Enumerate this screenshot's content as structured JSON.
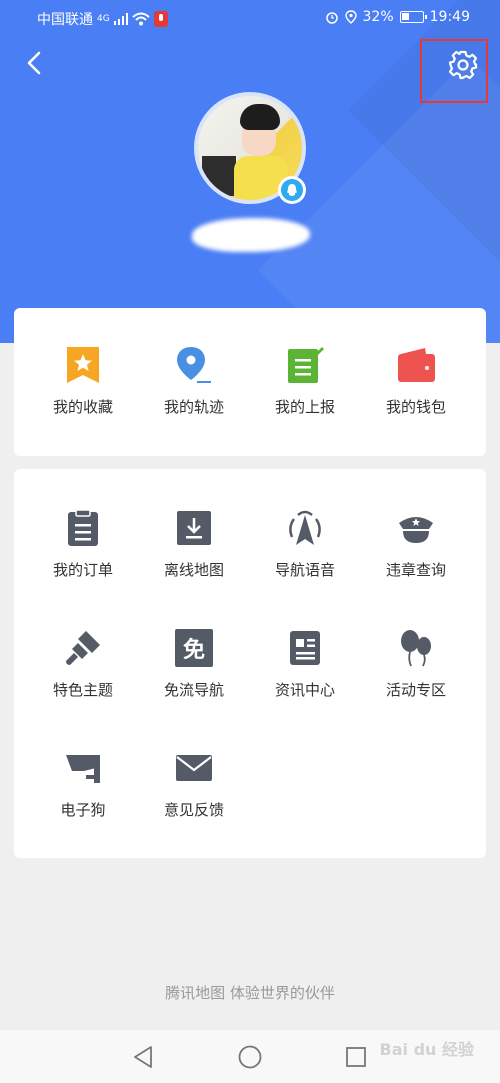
{
  "status_bar": {
    "carrier": "中国联通",
    "network": "4G",
    "battery": "32%",
    "time": "19:49"
  },
  "header": {
    "bg_color": "#4a7ef4",
    "back_icon": "chevron-left-icon",
    "settings_icon": "gear-icon",
    "highlight_color": "#e53935"
  },
  "quick_actions": [
    {
      "label": "我的收藏",
      "icon": "bookmark-star-icon",
      "color": "#f6a623"
    },
    {
      "label": "我的轨迹",
      "icon": "location-pin-icon",
      "color": "#4a90e2"
    },
    {
      "label": "我的上报",
      "icon": "report-note-icon",
      "color": "#5bb434"
    },
    {
      "label": "我的钱包",
      "icon": "wallet-icon",
      "color": "#ef5350"
    }
  ],
  "tools": [
    {
      "label": "我的订单",
      "icon": "clipboard-icon"
    },
    {
      "label": "离线地图",
      "icon": "download-map-icon"
    },
    {
      "label": "导航语音",
      "icon": "navigation-voice-icon"
    },
    {
      "label": "违章查询",
      "icon": "police-cap-icon"
    },
    {
      "label": "特色主题",
      "icon": "paint-brush-icon"
    },
    {
      "label": "免流导航",
      "icon": "free-data-icon",
      "glyph": "免"
    },
    {
      "label": "资讯中心",
      "icon": "news-icon"
    },
    {
      "label": "活动专区",
      "icon": "balloons-icon"
    },
    {
      "label": "电子狗",
      "icon": "speed-camera-icon"
    },
    {
      "label": "意见反馈",
      "icon": "mail-icon"
    }
  ],
  "footer": {
    "slogan": "腾讯地图  体验世界的伙伴"
  },
  "watermark": "Bai du 经验"
}
